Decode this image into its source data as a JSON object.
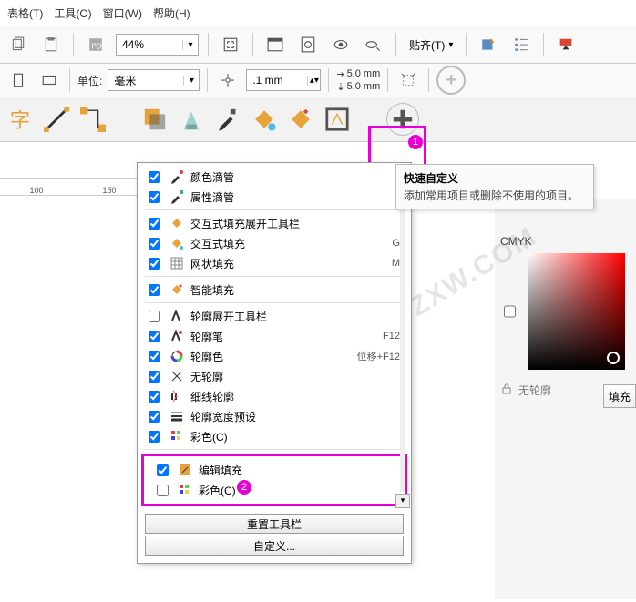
{
  "menu": {
    "table": "表格(T)",
    "tools": "工具(O)",
    "window": "窗口(W)",
    "help": "帮助(H)"
  },
  "toolbar1": {
    "zoom_value": "44%",
    "snap_label": "贴齐(T)"
  },
  "toolbar2": {
    "unit_label": "单位:",
    "unit_value": "毫米",
    "nudge_value": ".1 mm",
    "dup_x": "5.0 mm",
    "dup_y": "5.0 mm"
  },
  "tooltip": {
    "title": "快速自定义",
    "body": "添加常用项目或删除不使用的项目。"
  },
  "ruler": {
    "t1": "100",
    "t2": "150"
  },
  "annotations": {
    "badge1": "1",
    "badge2": "2"
  },
  "dropdown": {
    "items": [
      {
        "checked": true,
        "icon": "eyedropper-color",
        "label": "颜色滴管",
        "shortcut": ""
      },
      {
        "checked": true,
        "icon": "eyedropper-attr",
        "label": "属性滴管",
        "shortcut": ""
      }
    ],
    "group2": [
      {
        "checked": true,
        "icon": "fill-expand",
        "label": "交互式填充展开工具栏",
        "shortcut": ""
      },
      {
        "checked": true,
        "icon": "fill-interactive",
        "label": "交互式填充",
        "shortcut": "G"
      },
      {
        "checked": true,
        "icon": "mesh-fill",
        "label": "网状填充",
        "shortcut": "M"
      }
    ],
    "group3": [
      {
        "checked": true,
        "icon": "smart-fill",
        "label": "智能填充",
        "shortcut": ""
      }
    ],
    "group4": [
      {
        "checked": false,
        "icon": "outline-expand",
        "label": "轮廓展开工具栏",
        "shortcut": ""
      },
      {
        "checked": true,
        "icon": "outline-pen",
        "label": "轮廓笔",
        "shortcut": "F12"
      },
      {
        "checked": true,
        "icon": "outline-color",
        "label": "轮廓色",
        "shortcut": "位移+F12"
      },
      {
        "checked": true,
        "icon": "no-outline",
        "label": "无轮廓",
        "shortcut": ""
      },
      {
        "checked": true,
        "icon": "hairline",
        "label": "细线轮廓",
        "shortcut": ""
      },
      {
        "checked": true,
        "icon": "outline-width",
        "label": "轮廓宽度预设",
        "shortcut": ""
      },
      {
        "checked": true,
        "icon": "color-c",
        "label": "彩色(C)",
        "shortcut": ""
      }
    ],
    "group5": [
      {
        "checked": true,
        "icon": "edit-fill",
        "label": "编辑填充",
        "shortcut": ""
      },
      {
        "checked": false,
        "icon": "color-c2",
        "label": "彩色(C)",
        "shortcut": ""
      }
    ],
    "reset_btn": "重置工具栏",
    "custom_btn": "自定义..."
  },
  "right": {
    "cmyk_label": "CMYK",
    "no_outline": "无轮廓",
    "fill_btn": "填充"
  },
  "watermark": "软件自学网\nWWW.RJZXW.COM"
}
